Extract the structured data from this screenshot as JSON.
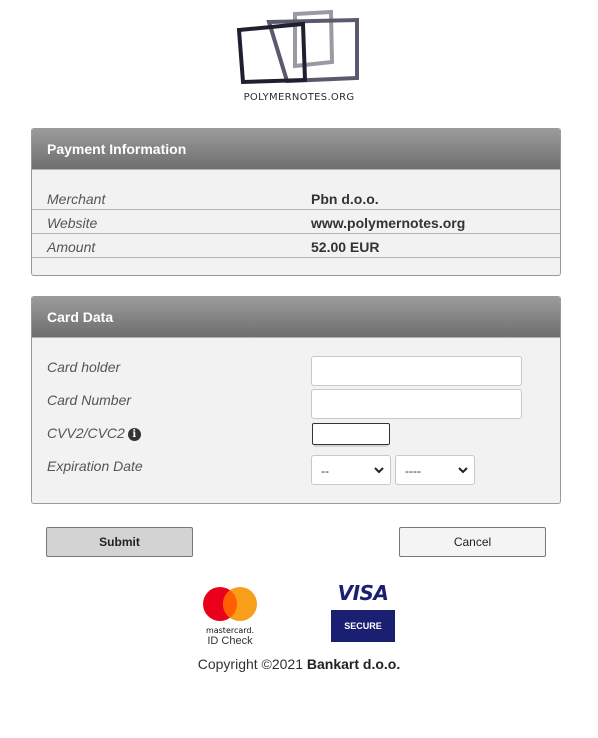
{
  "logo": {
    "text": "POLYMERNOTES.ORG"
  },
  "payment": {
    "title": "Payment Information",
    "rows": [
      {
        "label": "Merchant",
        "value": "Pbn d.o.o."
      },
      {
        "label": "Website",
        "value": "www.polymernotes.org"
      },
      {
        "label": "Amount",
        "value": "52.00 EUR"
      }
    ]
  },
  "card": {
    "title": "Card Data",
    "holder_label": "Card holder",
    "holder_value": "",
    "number_label": "Card Number",
    "number_value": "",
    "cvv_label": "CVV2/CVC2",
    "cvv_value": "",
    "expiry_label": "Expiration Date",
    "month_selected": "--",
    "year_selected": "----"
  },
  "buttons": {
    "submit": "Submit",
    "cancel": "Cancel"
  },
  "brands": {
    "mastercard_word": "mastercard.",
    "mastercard_sub": "ID Check",
    "visa_word": "VISA",
    "visa_sub": "SECURE"
  },
  "footer": {
    "copyright_prefix": "Copyright ©2021 ",
    "copyright_company": "Bankart d.o.o."
  },
  "colors": {
    "visa_blue": "#1a1f71",
    "mc_red": "#eb001b",
    "mc_orange": "#f79e1b",
    "header_gray": "#7a7a7a"
  }
}
